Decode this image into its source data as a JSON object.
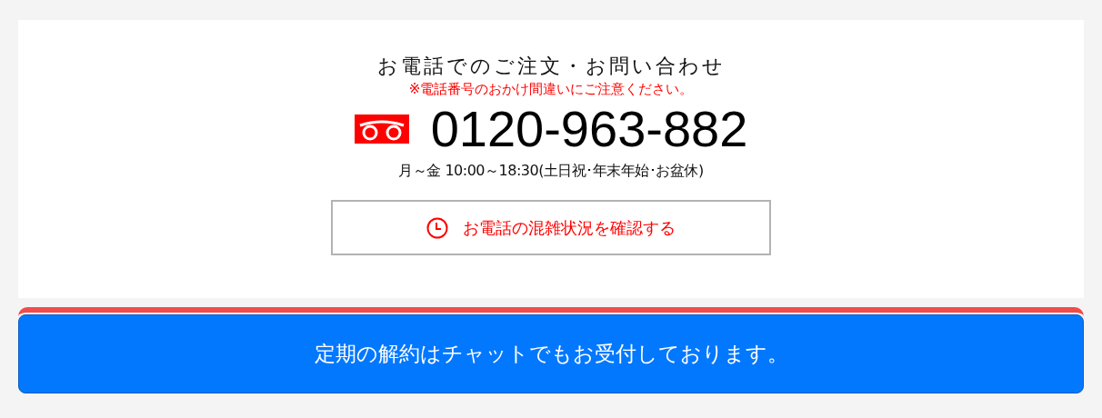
{
  "contact": {
    "heading": "お電話でのご注文・お問い合わせ",
    "notice": "※電話番号のおかけ間違いにご注意ください。",
    "phone": "0120-963-882",
    "hours": "月～金 10:00～18:30(土日祝･年末年始･お盆休)",
    "congestion_button": "お電話の混雑状況を確認する"
  },
  "chat_button": "定期の解約はチャットでもお受付しております。"
}
